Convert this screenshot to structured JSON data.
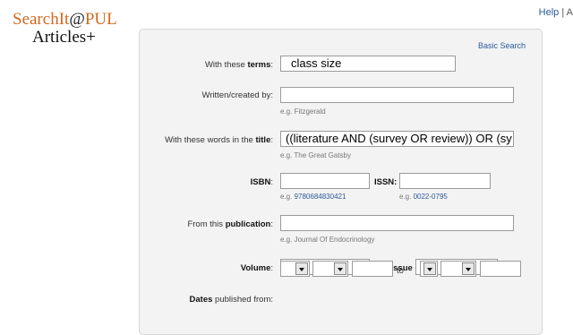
{
  "logo": {
    "line1_a": "SearchIt",
    "line1_at": "@",
    "line1_b": "PUL",
    "line2": "Articles+"
  },
  "toplinks": {
    "help": "Help",
    "sep": "| A"
  },
  "form": {
    "basic_search": "Basic Search",
    "terms": {
      "label_pre": "With these ",
      "label_bold": "terms",
      "label_post": ":",
      "value": "class size"
    },
    "author": {
      "label": "Written/created by:",
      "value": "",
      "hint": "e.g. Fitzgerald"
    },
    "title": {
      "label_pre": "With these words in the ",
      "label_bold": "title",
      "label_post": ":",
      "value": "((literature AND (survey OR review)) OR (sy",
      "hint": "e.g. The Great Gatsby"
    },
    "isbn": {
      "label": "ISBN",
      "colon": ":",
      "value": "",
      "hint_pre": "e.g. ",
      "hint_val": "9780684830421"
    },
    "issn": {
      "label": "ISSN:",
      "value": "",
      "hint_pre": "e.g. ",
      "hint_val": "0022-0795"
    },
    "publication": {
      "label_pre": "From this ",
      "label_bold": "publication",
      "label_post": ":",
      "value": "",
      "hint": "e.g. Journal Of Endocrinology"
    },
    "volume": {
      "label_bold": "Volume",
      "label_post": ":",
      "value": ""
    },
    "issue": {
      "label_pre": "and ",
      "label_bold": "Issue",
      "value": ""
    },
    "dates": {
      "label_bold": "Dates",
      "label_post": " published from:",
      "to": "to"
    }
  },
  "icons": {
    "dropdown": "chevron-down-icon"
  }
}
